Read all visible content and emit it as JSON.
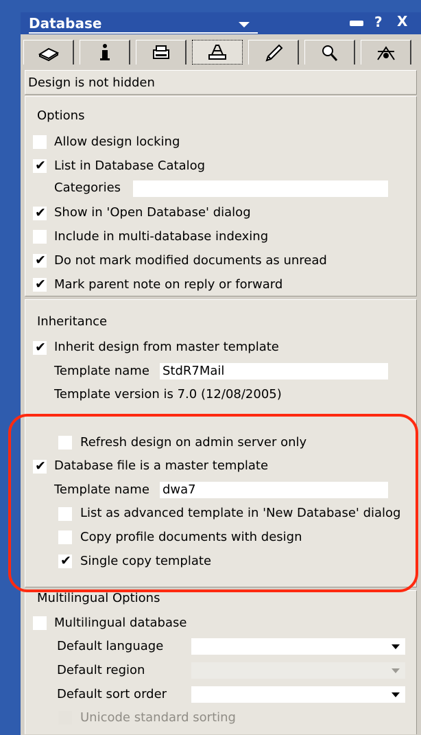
{
  "title": "Database",
  "tabs": [
    {
      "icon": "basics-icon"
    },
    {
      "icon": "info-icon"
    },
    {
      "icon": "printer-icon"
    },
    {
      "icon": "design-icon",
      "selected": true
    },
    {
      "icon": "launch-icon"
    },
    {
      "icon": "search-index-icon"
    },
    {
      "icon": "advanced-icon"
    }
  ],
  "status": "Design is not hidden",
  "options": {
    "header": "Options",
    "allow_design_locking": {
      "label": "Allow design locking",
      "checked": false
    },
    "list_in_catalog": {
      "label": "List in Database Catalog",
      "checked": true
    },
    "categories_label": "Categories",
    "categories_value": "",
    "show_in_open_dialog": {
      "label": "Show in 'Open Database' dialog",
      "checked": true
    },
    "multi_db_indexing": {
      "label": "Include in multi-database indexing",
      "checked": false
    },
    "do_not_mark_unread": {
      "label": "Do not mark modified documents as unread",
      "checked": true
    },
    "mark_parent_note": {
      "label": "Mark parent note on reply or forward",
      "checked": true
    }
  },
  "inheritance": {
    "header": "Inheritance",
    "inherit_design": {
      "label": "Inherit design from master template",
      "checked": true
    },
    "template_name_label": "Template name",
    "template_name_value": "StdR7Mail",
    "template_version": "Template version is 7.0 (12/08/2005)",
    "refresh_admin_only": {
      "label": "Refresh design on admin server only",
      "checked": false
    },
    "is_master_template": {
      "label": "Database file is a master template",
      "checked": true
    },
    "master_name_label": "Template name",
    "master_name_value": "dwa7",
    "list_advanced": {
      "label": "List as advanced template in 'New Database' dialog",
      "checked": false
    },
    "copy_profile_docs": {
      "label": "Copy profile documents with design",
      "checked": false
    },
    "single_copy": {
      "label": "Single copy template",
      "checked": true
    }
  },
  "multilingual": {
    "header": "Multilingual Options",
    "multilingual_db": {
      "label": "Multilingual database",
      "checked": false
    },
    "default_language_label": "Default language",
    "default_region_label": "Default region",
    "default_sort_label": "Default sort order",
    "unicode_sorting": {
      "label": "Unicode standard sorting",
      "checked": false
    }
  },
  "colors": {
    "highlight": "#ff2a10",
    "window_bg": "#2f5cae",
    "panel_bg": "#d4d0c8"
  }
}
